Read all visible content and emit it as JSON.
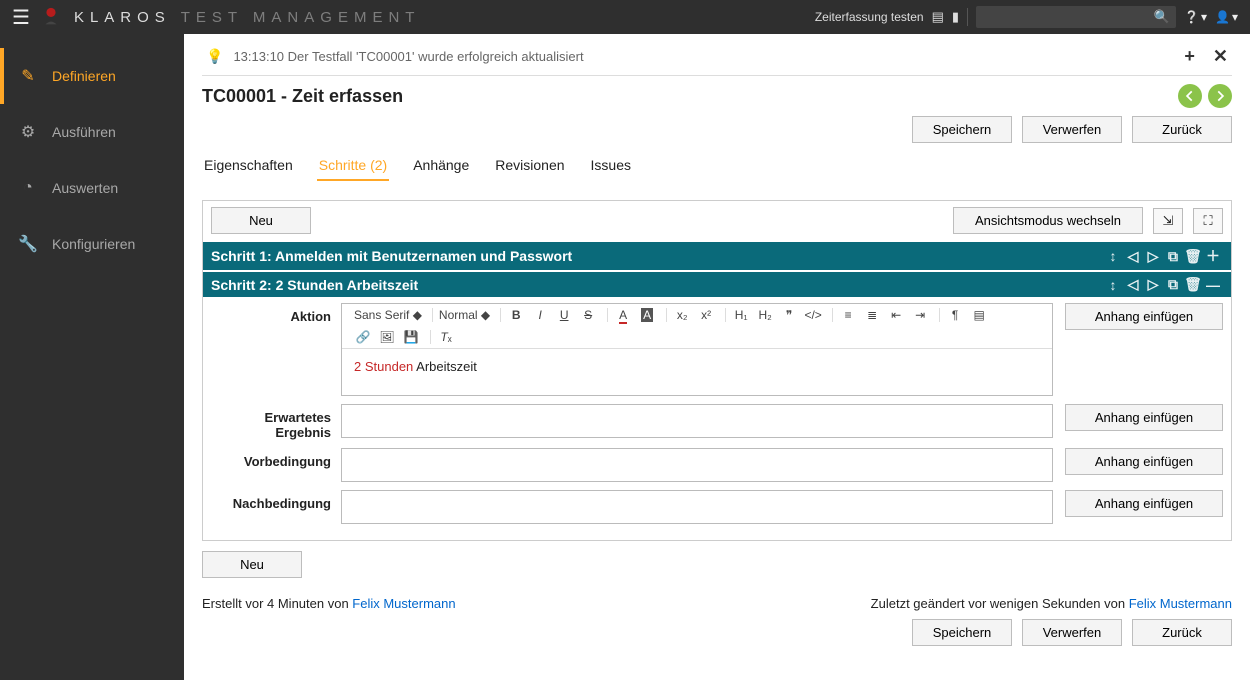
{
  "topbar": {
    "brand_strong": "KLAROS",
    "brand_light": "TEST MANAGEMENT",
    "quick_link": "Zeiterfassung testen",
    "search_placeholder": ""
  },
  "sidebar": {
    "items": [
      {
        "icon": "✎",
        "label": "Definieren",
        "active": true
      },
      {
        "icon": "⚙",
        "label": "Ausführen"
      },
      {
        "icon": "◔",
        "label": "Auswerten"
      },
      {
        "icon": "🔧",
        "label": "Konfigurieren"
      }
    ]
  },
  "infobar": {
    "message": "13:13:10 Der Testfall 'TC00001' wurde erfolgreich aktualisiert"
  },
  "page": {
    "title": "TC00001 - Zeit erfassen"
  },
  "buttons": {
    "save": "Speichern",
    "discard": "Verwerfen",
    "back": "Zurück",
    "new": "Neu",
    "toggle_view": "Ansichtsmodus wechseln",
    "attach": "Anhang einfügen"
  },
  "tabs": [
    {
      "label": "Eigenschaften"
    },
    {
      "label": "Schritte (2)",
      "active": true
    },
    {
      "label": "Anhänge"
    },
    {
      "label": "Revisionen"
    },
    {
      "label": "Issues"
    }
  ],
  "steps": {
    "step1_title": "Schritt 1: Anmelden mit Benutzernamen und Passwort",
    "step2_title": "Schritt 2: 2 Stunden Arbeitszeit",
    "labels": {
      "action": "Aktion",
      "expected": "Erwartetes Ergebnis",
      "precond": "Vorbedingung",
      "postcond": "Nachbedingung"
    },
    "editor": {
      "font": "Sans Serif",
      "size": "Normal",
      "content_red": "2 Stunden",
      "content_rest": " Arbeitszeit"
    }
  },
  "meta": {
    "created_prefix": "Erstellt vor 4 Minuten von ",
    "created_user": "Felix Mustermann",
    "modified_prefix": "Zuletzt geändert vor wenigen Sekunden von ",
    "modified_user": "Felix Mustermann"
  }
}
